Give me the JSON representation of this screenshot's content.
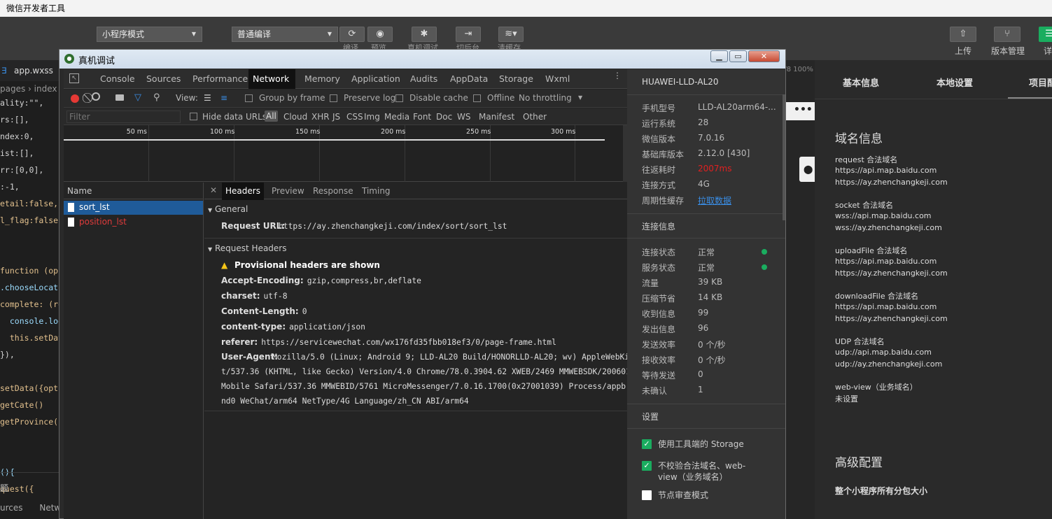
{
  "app": {
    "title": "微信开发者工具"
  },
  "toolbar": {
    "mode": "小程序模式",
    "compile": "普通编译",
    "cut_labels": [
      "编译",
      "预览",
      "真机调试",
      "切后台",
      "清缓存"
    ],
    "upload": "上传",
    "version_mgmt": "版本管理",
    "detail": "详"
  },
  "editor": {
    "file_tab": "app.wxss",
    "breadcrumb": "pages › index",
    "lines": [
      "ality:\"\",",
      "rs:[],",
      "ndex:0,",
      "ist:[],",
      "rr:[0,0],",
      ":-1,",
      "etail:false,",
      "l_flag:false",
      "",
      "",
      "function (op",
      ".chooseLocatio",
      "complete: (re",
      "  console.log",
      "  this.setDat",
      "}),",
      "",
      "setData({opti",
      "getCate()",
      "getProvince()",
      "",
      "",
      "(){",
      "quest({"
    ],
    "bottom": "题",
    "bottom_tabs": [
      "urces",
      "Netwo"
    ]
  },
  "sim": {
    "status": "7/8 100%",
    "dots": "•••"
  },
  "window": {
    "title": "真机调试"
  },
  "devtools": {
    "tabs": [
      "Console",
      "Sources",
      "Performance",
      "Network",
      "Memory",
      "Application",
      "Audits",
      "AppData",
      "Storage",
      "Wxml"
    ],
    "active_tab": "Network",
    "view_label": "View:",
    "group_by_frame": "Group by frame",
    "preserve_log": "Preserve log",
    "disable_cache": "Disable cache",
    "offline": "Offline",
    "throttling": "No throttling",
    "filter_placeholder": "Filter",
    "hide_data_urls": "Hide data URLs",
    "type_filters": [
      "All",
      "Cloud",
      "XHR",
      "JS",
      "CSS",
      "Img",
      "Media",
      "Font",
      "Doc",
      "WS",
      "Manifest",
      "Other"
    ],
    "timeline_ticks": [
      "50 ms",
      "100 ms",
      "150 ms",
      "200 ms",
      "250 ms",
      "300 ms"
    ],
    "name_header": "Name",
    "requests": [
      {
        "name": "sort_lst",
        "selected": true,
        "color": "#ffffff"
      },
      {
        "name": "position_lst",
        "selected": false,
        "color": "#e03b3b"
      }
    ],
    "detail_tabs": [
      "Headers",
      "Preview",
      "Response",
      "Timing"
    ],
    "general_title": "General",
    "request_url_label": "Request URL:",
    "request_url": "https://ay.zhenchangkeji.com/index/sort/sort_lst",
    "req_headers_title": "Request Headers",
    "provisional": "Provisional headers are shown",
    "headers": [
      {
        "k": "Accept-Encoding:",
        "v": "gzip,compress,br,deflate"
      },
      {
        "k": "charset:",
        "v": "utf-8"
      },
      {
        "k": "Content-Length:",
        "v": "0"
      },
      {
        "k": "content-type:",
        "v": "application/json"
      },
      {
        "k": "referer:",
        "v": "https://servicewechat.com/wx176fd35fbb018ef3/0/page-frame.html"
      }
    ],
    "ua_label": "User-Agent:",
    "ua_lines": [
      "Mozilla/5.0 (Linux; Android 9; LLD-AL20 Build/HONORLLD-AL20; wv) AppleWebKi",
      "t/537.36 (KHTML, like Gecko) Version/4.0 Chrome/78.0.3904.62 XWEB/2469 MMWEBSDK/200601",
      "Mobile Safari/537.36 MMWEBID/5761 MicroMessenger/7.0.16.1700(0x27001039) Process/appbra",
      "nd0 WeChat/arm64 NetType/4G Language/zh_CN ABI/arm64"
    ]
  },
  "device": {
    "name": "HUAWEI-LLD-AL20",
    "rows": [
      {
        "k": "手机型号",
        "v": "LLD-AL20arm64-..."
      },
      {
        "k": "运行系统",
        "v": "28"
      },
      {
        "k": "微信版本",
        "v": "7.0.16"
      },
      {
        "k": "基础库版本",
        "v": "2.12.0 [430]"
      },
      {
        "k": "往返耗时",
        "v": "2007ms",
        "color": "#e02020"
      },
      {
        "k": "连接方式",
        "v": "4G"
      },
      {
        "k": "周期性缓存",
        "v": "拉取数据",
        "color": "#3a8ee6"
      }
    ],
    "conn_title": "连接信息",
    "conn_rows": [
      {
        "k": "连接状态",
        "v": "正常"
      },
      {
        "k": "服务状态",
        "v": "正常"
      },
      {
        "k": "流量",
        "v": "39 KB"
      },
      {
        "k": "压缩节省",
        "v": "14 KB"
      },
      {
        "k": "收到信息",
        "v": "99"
      },
      {
        "k": "发出信息",
        "v": "96"
      },
      {
        "k": "发送效率",
        "v": "0 个/秒"
      },
      {
        "k": "接收效率",
        "v": "0 个/秒"
      },
      {
        "k": "等待发送",
        "v": "0"
      },
      {
        "k": "未确认",
        "v": "1"
      }
    ],
    "settings_title": "设置",
    "settings": [
      "使用工具端的 Storage",
      "不校验合法域名、web-view（业务域名）",
      "节点审查模式"
    ],
    "settings_line2": "view（业务域名）",
    "settings_line1": "不校验合法域名、web-"
  },
  "right": {
    "tabs": [
      "基本信息",
      "本地设置",
      "项目配"
    ],
    "domain_title": "域名信息",
    "domains": [
      {
        "label": "request 合法域名",
        "items": [
          "https://api.map.baidu.com",
          "https://ay.zhenchangkeji.com"
        ]
      },
      {
        "label": "socket 合法域名",
        "items": [
          "wss://api.map.baidu.com",
          "wss://ay.zhenchangkeji.com"
        ]
      },
      {
        "label": "uploadFile 合法域名",
        "items": [
          "https://api.map.baidu.com",
          "https://ay.zhenchangkeji.com"
        ]
      },
      {
        "label": "downloadFile 合法域名",
        "items": [
          "https://api.map.baidu.com",
          "https://ay.zhenchangkeji.com"
        ]
      },
      {
        "label": "UDP 合法域名",
        "items": [
          "udp://api.map.baidu.com",
          "udp://ay.zhenchangkeji.com"
        ]
      },
      {
        "label": "web-view（业务域名）",
        "items": [
          "未设置"
        ]
      }
    ],
    "advanced_title": "高级配置",
    "subpkg": "整个小程序所有分包大小"
  },
  "colors": {
    "accent": "#1aad5f",
    "link": "#3a8ee6",
    "error": "#e02020",
    "selected": "#1f5b99"
  }
}
